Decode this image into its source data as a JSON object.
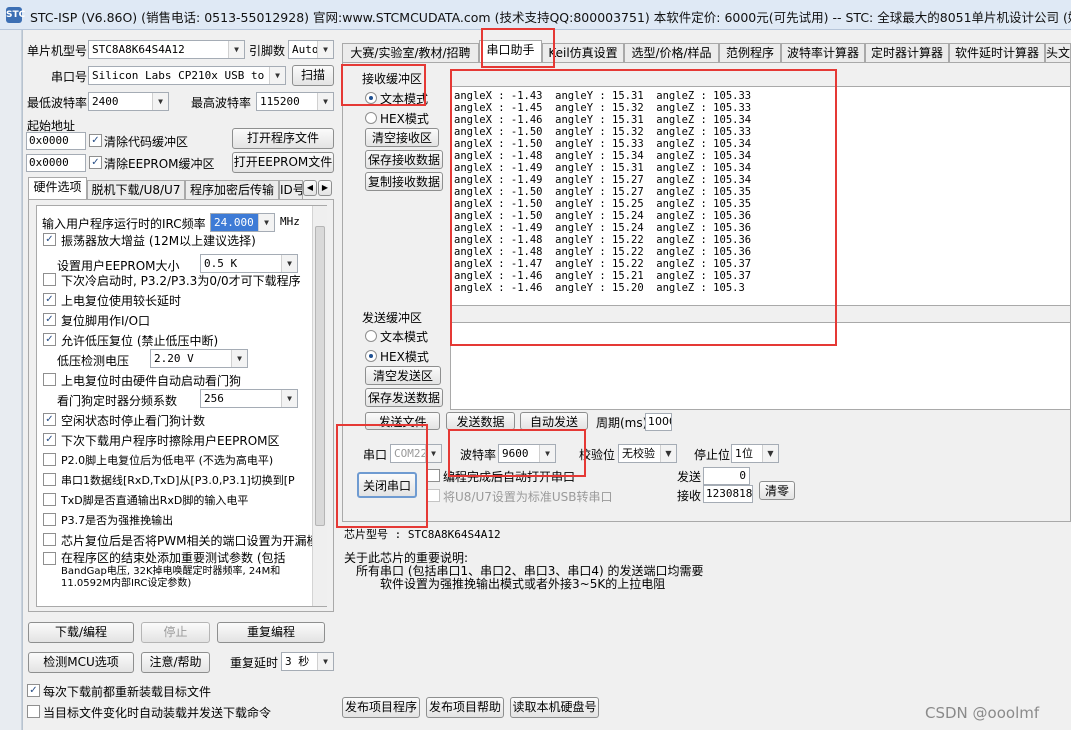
{
  "title": "STC-ISP (V6.86O) (销售电话: 0513-55012928) 官网:www.STCMCUDATA.com  (技术支持QQ:800003751) 本软件定价: 6000元(可先试用) -- STC: 全球最大的8051单片机设计公司 (姚永平)",
  "title_icon": "STC",
  "left": {
    "mcu_model_label": "单片机型号",
    "mcu_model_value": "STC8A8K64S4A12",
    "pin_count_label": "引脚数",
    "pin_count_value": "Auto",
    "port_label": "串口号",
    "port_value": "Silicon Labs CP210x USB to UAR",
    "scan_button": "扫描",
    "min_baud_label": "最低波特率",
    "min_baud_value": "2400",
    "max_baud_label": "最高波特率",
    "max_baud_value": "115200",
    "start_addr_label": "起始地址",
    "code_addr_value": "0x0000",
    "clear_code_label": "清除代码缓冲区",
    "open_program_button": "打开程序文件",
    "eeprom_addr_value": "0x0000",
    "clear_eeprom_label": "清除EEPROM缓冲区",
    "open_eeprom_button": "打开EEPROM文件",
    "tabs": [
      "硬件选项",
      "脱机下载/U8/U7",
      "程序加密后传输",
      "ID号"
    ],
    "hw": {
      "irc_label": "输入用户程序运行时的IRC频率",
      "irc_value": "24.000",
      "irc_unit": "MHz",
      "options": [
        {
          "label": "振荡器放大增益 (12M以上建议选择)",
          "checked": true
        },
        {
          "label": "下次冷启动时, P3.2/P3.3为0/0才可下载程序",
          "checked": false
        },
        {
          "label": "上电复位使用较长延时",
          "checked": true
        },
        {
          "label": "复位脚用作I/O口",
          "checked": true
        },
        {
          "label": "允许低压复位 (禁止低压中断)",
          "checked": true
        },
        {
          "label": "上电复位时由硬件自动启动看门狗",
          "checked": false
        },
        {
          "label": "空闲状态时停止看门狗计数",
          "checked": true
        },
        {
          "label": "下次下载用户程序时擦除用户EEPROM区",
          "checked": true
        },
        {
          "label": "P2.0脚上电复位后为低电平 (不选为高电平)",
          "checked": false
        },
        {
          "label": "串口1数据线[RxD,TxD]从[P3.0,P3.1]切换到[P",
          "checked": false
        },
        {
          "label": "TxD脚是否直通输出RxD脚的输入电平",
          "checked": false
        },
        {
          "label": "P3.7是否为强推挽输出",
          "checked": false
        },
        {
          "label": "芯片复位后是否将PWM相关的端口设置为开漏模",
          "checked": false
        }
      ],
      "last_option_lines": [
        "在程序区的结束处添加重要测试参数 (包括",
        "BandGap电压, 32K掉电唤醒定时器频率, 24M和",
        "11.0592M内部IRC设定参数)"
      ],
      "eeprom_size_label": "设置用户EEPROM大小",
      "eeprom_size_value": "0.5 K",
      "lvd_label": "低压检测电压",
      "lvd_value": "2.20 V",
      "wdt_label": "看门狗定时器分频系数",
      "wdt_value": "256"
    },
    "download_button": "下载/编程",
    "stop_button": "停止",
    "reprogram_button": "重复编程",
    "detect_button": "检测MCU选项",
    "help_button": "注意/帮助",
    "retry_delay_label": "重复延时",
    "retry_delay_value": "3 秒",
    "reload_label": "每次下载前都重新装载目标文件",
    "auto_send_label": "当目标文件变化时自动装载并发送下载命令"
  },
  "right": {
    "tabs": [
      "大赛/实验室/教材/招聘",
      "串口助手",
      "Keil仿真设置",
      "选型/价格/样品",
      "范例程序",
      "波特率计算器",
      "定时器计算器",
      "软件延时计算器",
      "头文"
    ],
    "active_tab": "串口助手",
    "recv": {
      "group_label": "接收缓冲区",
      "text_mode": "文本模式",
      "hex_mode": "HEX模式",
      "clear_button": "清空接收区",
      "save_button": "保存接收数据",
      "copy_button": "复制接收数据",
      "lines": [
        "angleX : -1.43  angleY : 15.31  angleZ : 105.33",
        "angleX : -1.45  angleY : 15.32  angleZ : 105.33",
        "angleX : -1.46  angleY : 15.31  angleZ : 105.34",
        "angleX : -1.50  angleY : 15.32  angleZ : 105.33",
        "angleX : -1.50  angleY : 15.33  angleZ : 105.34",
        "angleX : -1.48  angleY : 15.34  angleZ : 105.34",
        "angleX : -1.49  angleY : 15.31  angleZ : 105.34",
        "angleX : -1.49  angleY : 15.27  angleZ : 105.34",
        "angleX : -1.50  angleY : 15.27  angleZ : 105.35",
        "angleX : -1.50  angleY : 15.25  angleZ : 105.35",
        "angleX : -1.50  angleY : 15.24  angleZ : 105.36",
        "angleX : -1.49  angleY : 15.24  angleZ : 105.36",
        "angleX : -1.48  angleY : 15.22  angleZ : 105.36",
        "angleX : -1.48  angleY : 15.22  angleZ : 105.36",
        "angleX : -1.47  angleY : 15.22  angleZ : 105.37",
        "angleX : -1.46  angleY : 15.21  angleZ : 105.37",
        "angleX : -1.46  angleY : 15.20  angleZ : 105.3"
      ]
    },
    "send": {
      "group_label": "发送缓冲区",
      "text_mode": "文本模式",
      "hex_mode": "HEX模式",
      "clear_button": "清空发送区",
      "save_button": "保存发送数据",
      "send_file_button": "发送文件",
      "send_data_button": "发送数据",
      "auto_send_button": "自动发送",
      "period_label": "周期(ms)",
      "period_value": "1000"
    },
    "port": {
      "port_label": "串口",
      "port_value": "COM22",
      "baud_label": "波特率",
      "baud_value": "9600",
      "parity_label": "校验位",
      "parity_value": "无校验",
      "stop_label": "停止位",
      "stop_value": "1位",
      "close_button": "关闭串口",
      "auto_open_label": "编程完成后自动打开串口",
      "usb_label": "将U8/U7设置为标准USB转串口",
      "sent_label": "发送",
      "sent_value": "0",
      "recv_label": "接收",
      "recv_value": "1230818",
      "clear_button": "清零"
    },
    "info": {
      "chip_line": "芯片型号 : STC8A8K64S4A12",
      "note_title": "关于此芯片的重要说明:",
      "note_line1": "所有串口 (包括串口1、串口2、串口3、串口4) 的发送端口均需要",
      "note_line2": "软件设置为强推挽输出模式或者外接3~5K的上拉电阻"
    },
    "publish_button": "发布项目程序",
    "publish_help_button": "发布项目帮助",
    "read_disk_button": "读取本机硬盘号"
  },
  "watermark": "CSDN @ooolmf"
}
